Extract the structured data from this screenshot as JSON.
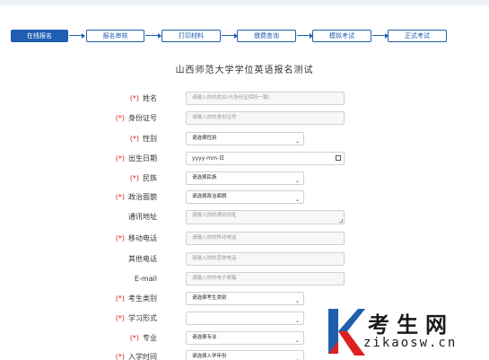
{
  "steps": [
    "在线报名",
    "报名审核",
    "打印材料",
    "缴费查询",
    "模拟考试",
    "正式考试"
  ],
  "form_title": "山西师范大学学位英语报名测试",
  "required_mark": "(*)",
  "fields": [
    {
      "label": "姓名",
      "required": true,
      "type": "text",
      "placeholder": "请输入你的姓名(与身份证保持一致)"
    },
    {
      "label": "身份证号",
      "required": true,
      "type": "text",
      "placeholder": "请输入你的身份证号"
    },
    {
      "label": "性别",
      "required": true,
      "type": "select",
      "value": "请选择性别"
    },
    {
      "label": "出生日期",
      "required": true,
      "type": "date",
      "value": "yyyy-mm-日"
    },
    {
      "label": "民族",
      "required": true,
      "type": "select",
      "value": "请选择民族"
    },
    {
      "label": "政治面貌",
      "required": true,
      "type": "select",
      "value": "请选择政治面貌"
    },
    {
      "label": "通讯地址",
      "required": false,
      "type": "textarea",
      "placeholder": "请输入你的通讯地址"
    },
    {
      "label": "移动电话",
      "required": true,
      "type": "text",
      "placeholder": "请输入你的移动电话"
    },
    {
      "label": "其他电话",
      "required": false,
      "type": "text",
      "placeholder": "请输入你的其他电话"
    },
    {
      "label": "E-mail",
      "required": false,
      "type": "text",
      "placeholder": "请输入你的电子邮箱"
    },
    {
      "label": "考生类别",
      "required": true,
      "type": "select",
      "value": "请选择考生类别"
    },
    {
      "label": "学习形式",
      "required": true,
      "type": "select",
      "value": ""
    },
    {
      "label": "专业",
      "required": true,
      "type": "select",
      "value": "请选择专业"
    },
    {
      "label": "入学时间",
      "required": true,
      "type": "select",
      "value": "请选择入学年份"
    }
  ],
  "watermark": {
    "text": "考生网",
    "url": "zikaosw.cn"
  },
  "colors": {
    "accent": "#1f5eb0",
    "required": "#e02020",
    "logo_blue": "#1f5eb0",
    "logo_red": "#e02020"
  }
}
